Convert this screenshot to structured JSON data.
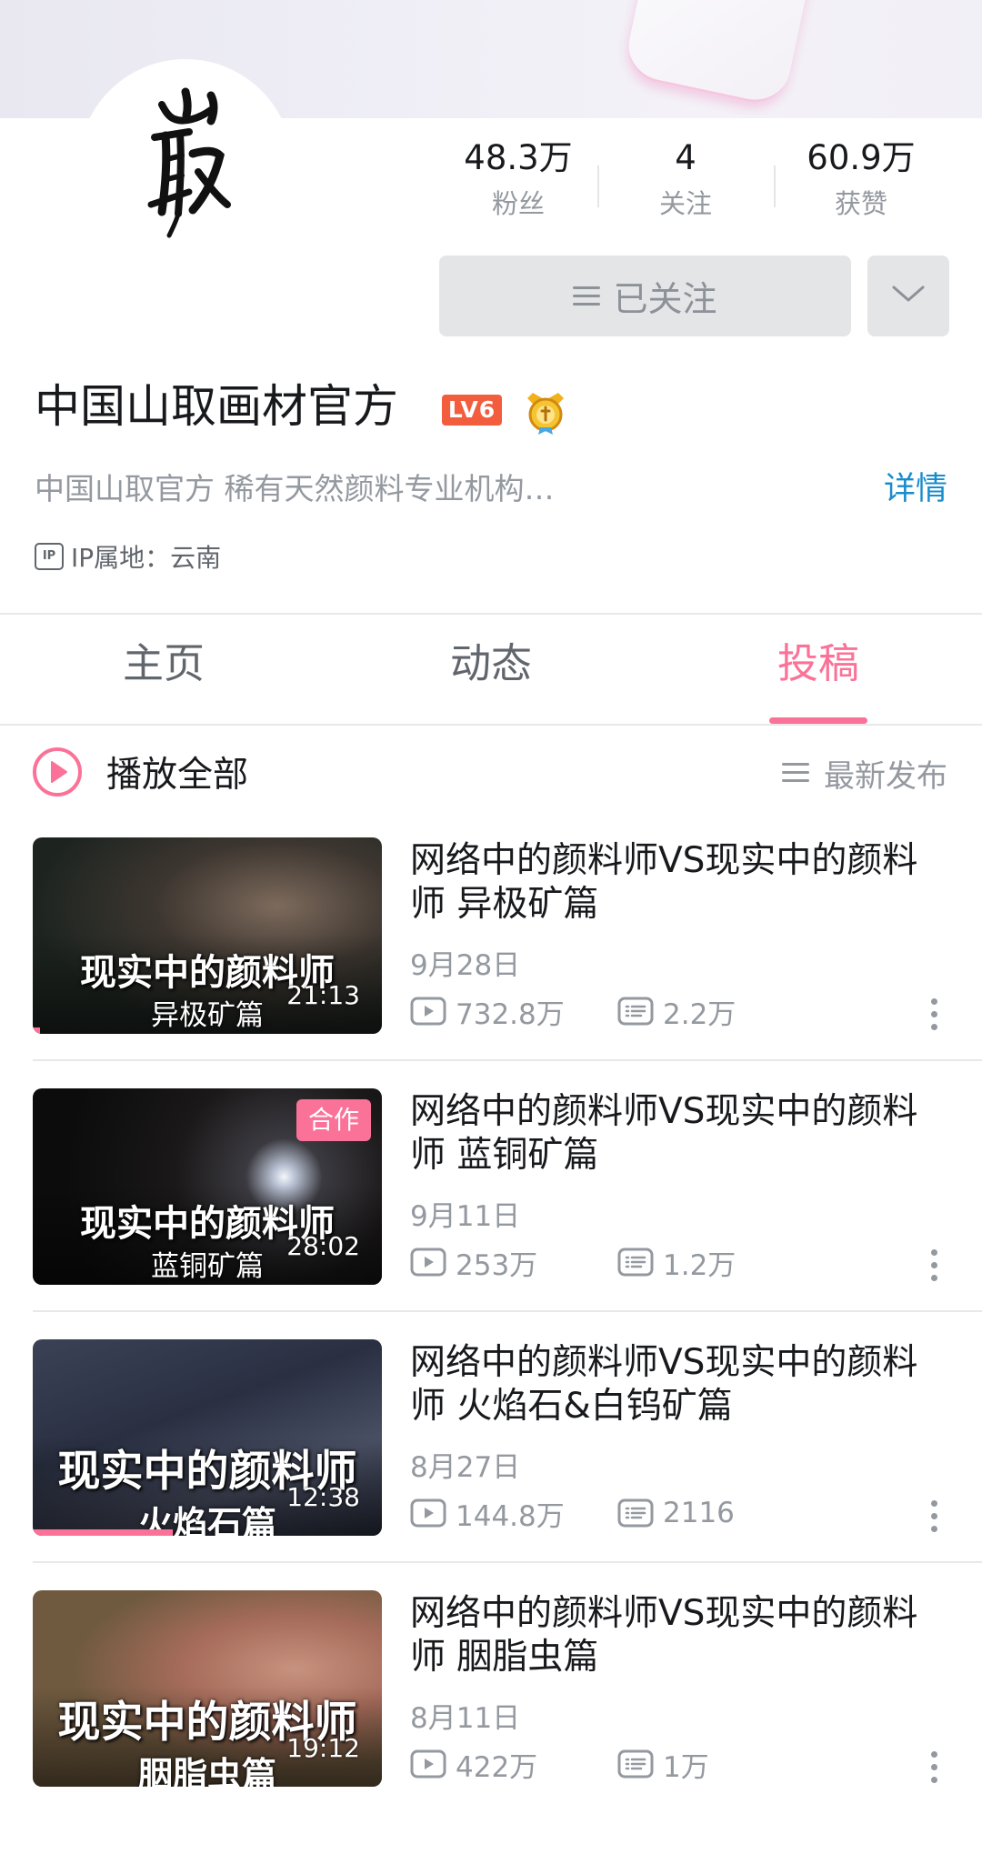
{
  "profile": {
    "name": "中国山取画材官方",
    "level_badge": "LV6",
    "bio": "中国山取官方 稀有天然颜料专业机构…",
    "detail_link": "详情",
    "ip_icon_text": "IP",
    "ip_location": "IP属地：云南",
    "avatar_icon": "calligraphy-logo-icon",
    "medal_icon": "medal-badge-icon"
  },
  "stats": [
    {
      "value": "48.3万",
      "label": "粉丝"
    },
    {
      "value": "4",
      "label": "关注"
    },
    {
      "value": "60.9万",
      "label": "获赞"
    }
  ],
  "actions": {
    "follow_label": "已关注",
    "dropdown_icon": "chevron-down-icon"
  },
  "tabs": [
    {
      "label": "主页",
      "active": false
    },
    {
      "label": "动态",
      "active": false
    },
    {
      "label": "投稿",
      "active": true
    }
  ],
  "toolbar": {
    "play_all_label": "播放全部",
    "sort_label": "最新发布"
  },
  "videos": [
    {
      "title": "网络中的颜料师VS现实中的颜料师 异极矿篇",
      "thumb_title": "现实中的颜料师",
      "thumb_sub": "异极矿篇",
      "duration": "21:13",
      "date": "9月28日",
      "plays": "732.8万",
      "comments": "2.2万",
      "badge": "",
      "progress_fraction": 0.02
    },
    {
      "title": "网络中的颜料师VS现实中的颜料师 蓝铜矿篇",
      "thumb_title": "现实中的颜料师",
      "thumb_sub": "蓝铜矿篇",
      "duration": "28:02",
      "date": "9月11日",
      "plays": "253万",
      "comments": "1.2万",
      "badge": "合作",
      "progress_fraction": 0
    },
    {
      "title": "网络中的颜料师VS现实中的颜料师 火焰石&白钨矿篇",
      "thumb_title": "现实中的颜料师",
      "thumb_sub": "火焰石篇",
      "duration": "12:38",
      "date": "8月27日",
      "plays": "144.8万",
      "comments": "2116",
      "badge": "",
      "progress_fraction": 0.4
    },
    {
      "title": "网络中的颜料师VS现实中的颜料师 胭脂虫篇",
      "thumb_title": "现实中的颜料师",
      "thumb_sub": "胭脂虫篇",
      "duration": "19:12",
      "date": "8月11日",
      "plays": "422万",
      "comments": "1万",
      "badge": "",
      "progress_fraction": 0
    }
  ],
  "colors": {
    "accent": "#fb7299",
    "link": "#1a8ccc",
    "text_primary": "#18191c",
    "text_secondary": "#9499a0",
    "level_badge": "#f25d3e"
  }
}
